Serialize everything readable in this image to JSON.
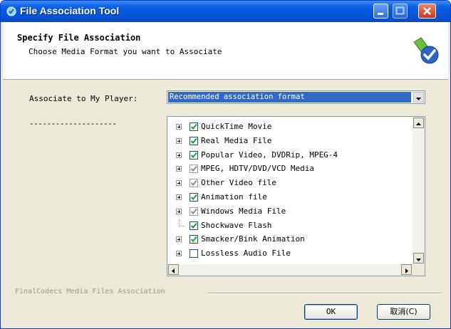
{
  "window": {
    "title": "File Association Tool"
  },
  "header": {
    "title": "Specify File Association",
    "subtitle": "Choose Media Format you want to Associate",
    "icon": "checkmark-badge-icon"
  },
  "form": {
    "associate_label": "Associate to My Player:",
    "dashes": "--------------------",
    "combo_value": "Recommended association format"
  },
  "tree": {
    "items": [
      {
        "label": "QuickTime Movie",
        "expandable": true,
        "checked": true,
        "gray": false
      },
      {
        "label": "Real Media File",
        "expandable": true,
        "checked": true,
        "gray": false
      },
      {
        "label": "Popular Video, DVDRip, MPEG-4",
        "expandable": true,
        "checked": true,
        "gray": false
      },
      {
        "label": "MPEG, HDTV/DVD/VCD Media",
        "expandable": true,
        "checked": true,
        "gray": true
      },
      {
        "label": "Other Video file",
        "expandable": true,
        "checked": true,
        "gray": true
      },
      {
        "label": "Animation file",
        "expandable": true,
        "checked": true,
        "gray": false
      },
      {
        "label": "Windows Media File",
        "expandable": true,
        "checked": true,
        "gray": true
      },
      {
        "label": "Shockwave Flash",
        "expandable": false,
        "checked": true,
        "gray": false
      },
      {
        "label": "Smacker/Bink Animation",
        "expandable": true,
        "checked": true,
        "gray": false
      },
      {
        "label": "Lossless Audio File",
        "expandable": true,
        "checked": false,
        "gray": false
      }
    ]
  },
  "footer": {
    "label": "FinalCodecs Media Files Association",
    "ok_label": "OK",
    "cancel_label": "取消(C)"
  },
  "colors": {
    "titlebar": "#0355d8",
    "selection": "#316ac5"
  }
}
